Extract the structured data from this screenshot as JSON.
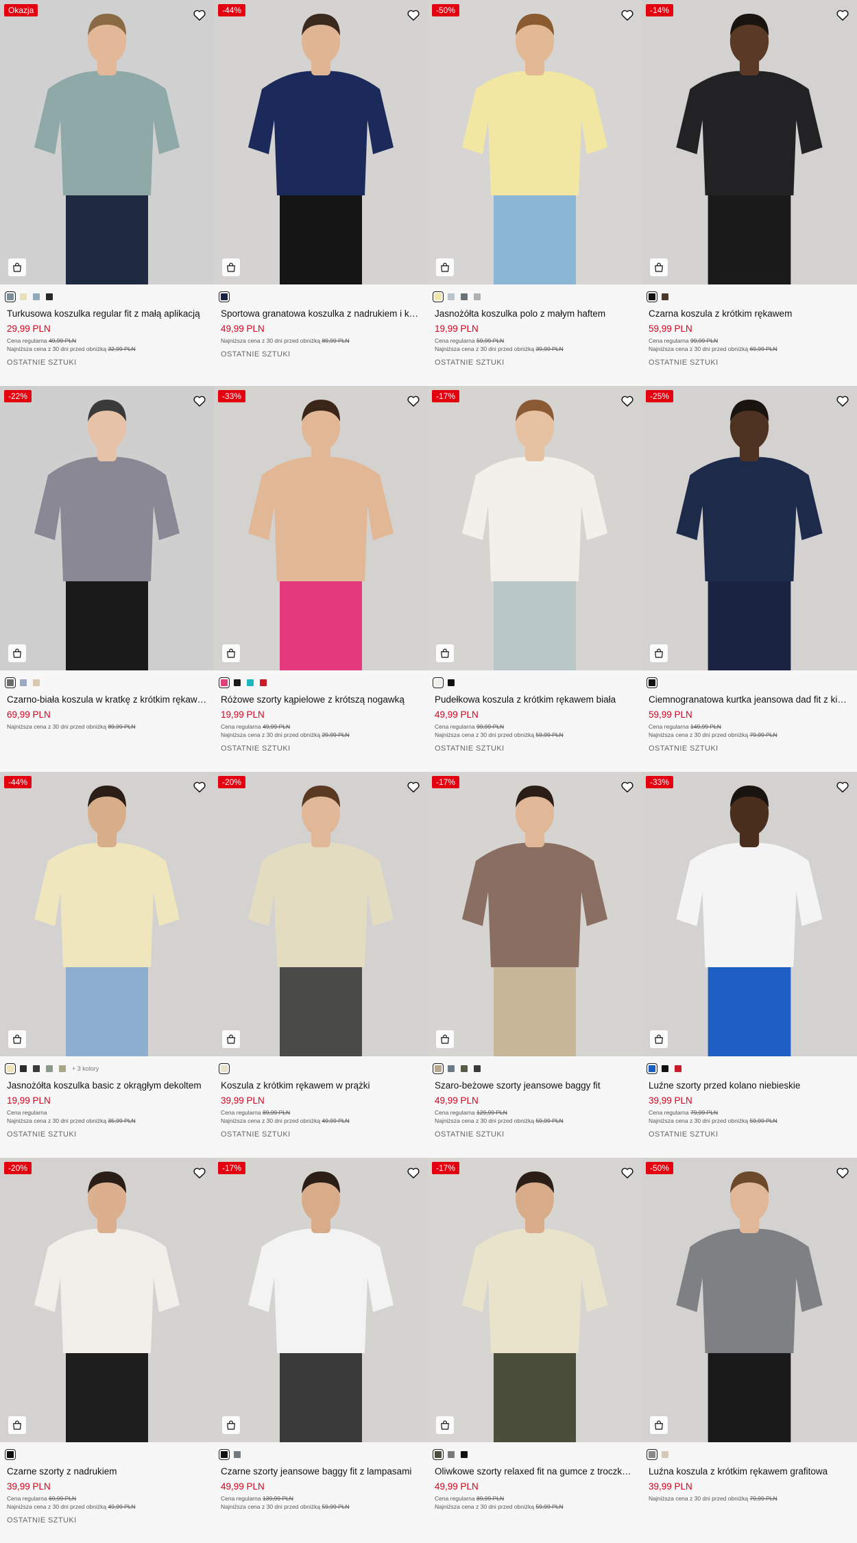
{
  "colors": {
    "badge": "#e3000f",
    "price": "#d6001c"
  },
  "products": [
    {
      "badge": "Okazja",
      "name": "Turkusowa koszulka regular fit z małą aplikacją",
      "price": "29,99 PLN",
      "regular_label": "Cena regularna",
      "regular": "49,99 PLN",
      "lowest_label": "Najniższa cena z 30 dni przed obniżką",
      "lowest": "32,99 PLN",
      "last": "OSTATNIE SZTUKI",
      "swatches": [
        "#7a8f96",
        "#e8e0b8",
        "#8fa9b8",
        "#2a2a2a"
      ],
      "more": "",
      "bg": "#cfd0cf",
      "shirt": "#8fa8a8",
      "pants": "#1e2a40",
      "skin": "#e2b899",
      "hair": "#8a6a44"
    },
    {
      "badge": "-44%",
      "name": "Sportowa granatowa koszulka z nadrukiem i kołnierzykiem",
      "price": "49,99 PLN",
      "regular_label": "",
      "regular": "",
      "lowest_label": "Najniższa cena z 30 dni przed obniżką",
      "lowest": "89,99 PLN",
      "last": "OSTATNIE SZTUKI",
      "swatches": [
        "#1a2340"
      ],
      "more": "",
      "bg": "#d4d3d1",
      "shirt": "#1b2a5a",
      "pants": "#151515",
      "skin": "#e0b594",
      "hair": "#3a2a1e"
    },
    {
      "badge": "-50%",
      "name": "Jasnożółta koszulka polo z małym haftem",
      "price": "19,99 PLN",
      "regular_label": "Cena regularna",
      "regular": "59,99 PLN",
      "lowest_label": "Najniższa cena z 30 dni przed obniżką",
      "lowest": "39,99 PLN",
      "last": "OSTATNIE SZTUKI",
      "swatches": [
        "#f0e6a8",
        "#b9c4cc",
        "#6c7378",
        "#b0b0b0"
      ],
      "more": "",
      "bg": "#d6d5d3",
      "shirt": "#f1e7a2",
      "pants": "#8bb6d6",
      "skin": "#e3b995",
      "hair": "#8a5a30"
    },
    {
      "badge": "-14%",
      "name": "Czarna koszula z krótkim rękawem",
      "price": "59,99 PLN",
      "regular_label": "Cena regularna",
      "regular": "99,99 PLN",
      "lowest_label": "Najniższa cena z 30 dni przed obniżką",
      "lowest": "69,99 PLN",
      "last": "OSTATNIE SZTUKI",
      "swatches": [
        "#111111",
        "#4a3a2a"
      ],
      "more": "",
      "bg": "#d3d2d0",
      "shirt": "#222224",
      "pants": "#1a1a1a",
      "skin": "#5a3a26",
      "hair": "#1a1410"
    },
    {
      "badge": "-22%",
      "name": "Czarno-biała koszula w kratkę z krótkim rękawem",
      "price": "69,99 PLN",
      "regular_label": "",
      "regular": "",
      "lowest_label": "Najniższa cena z 30 dni przed obniżką",
      "lowest": "89,99 PLN",
      "last": "",
      "swatches": [
        "#6c6c6c",
        "#9aa8c2",
        "#d8c8b0"
      ],
      "more": "",
      "bg": "#cfcfcf",
      "shirt": "#8a8894",
      "pants": "#1a1a1a",
      "skin": "#e6c3a8",
      "hair": "#3a3a3a"
    },
    {
      "badge": "-33%",
      "name": "Różowe szorty kąpielowe z krótszą nogawką",
      "price": "19,99 PLN",
      "regular_label": "Cena regularna",
      "regular": "49,99 PLN",
      "lowest_label": "Najniższa cena z 30 dni przed obniżką",
      "lowest": "29,99 PLN",
      "last": "OSTATNIE SZTUKI",
      "swatches": [
        "#e0407a",
        "#1a1a1a",
        "#1ab7c0",
        "#cc1a2a"
      ],
      "more": "",
      "bg": "#d3d2cf",
      "shirt": "#e1b796",
      "pants": "#e23a7c",
      "skin": "#e1b796",
      "hair": "#3a2618"
    },
    {
      "badge": "-17%",
      "name": "Pudełkowa koszula z krótkim rękawem biała",
      "price": "49,99 PLN",
      "regular_label": "Cena regularna",
      "regular": "99,99 PLN",
      "lowest_label": "Najniższa cena z 30 dni przed obniżką",
      "lowest": "59,99 PLN",
      "last": "OSTATNIE SZTUKI",
      "swatches": [
        "#eeeeea",
        "#111111"
      ],
      "more": "",
      "bg": "#d5d4d1",
      "shirt": "#f1f0ea",
      "pants": "#b9c7c9",
      "skin": "#e6c1a2",
      "hair": "#8a5a34"
    },
    {
      "badge": "-25%",
      "name": "Ciemnogranatowa kurtka jeansowa dad fit z kieszeniami",
      "price": "59,99 PLN",
      "regular_label": "Cena regularna",
      "regular": "149,99 PLN",
      "lowest_label": "Najniższa cena z 30 dni przed obniżką",
      "lowest": "79,99 PLN",
      "last": "OSTATNIE SZTUKI",
      "swatches": [
        "#111111"
      ],
      "more": "",
      "bg": "#d3d2d0",
      "shirt": "#1d2a4a",
      "pants": "#1a2440",
      "skin": "#4e3222",
      "hair": "#1a1410"
    },
    {
      "badge": "-44%",
      "name": "Jasnożółta koszulka basic z okrągłym dekoltem",
      "price": "19,99 PLN",
      "regular_label": "Cena regularna",
      "regular": "",
      "lowest_label": "Najniższa cena z 30 dni przed obniżką",
      "lowest": "35,99 PLN",
      "last": "OSTATNIE SZTUKI",
      "swatches": [
        "#efe3b8",
        "#2a2a2a",
        "#3a3a3a",
        "#8a9a8a",
        "#a8a888"
      ],
      "more": "+ 3 kolory",
      "bg": "#d3d2d0",
      "shirt": "#efe6be",
      "pants": "#8eaed0",
      "skin": "#d8ae8a",
      "hair": "#2a1e16"
    },
    {
      "badge": "-20%",
      "name": "Koszula z krótkim rękawem w prążki",
      "price": "39,99 PLN",
      "regular_label": "Cena regularna",
      "regular": "89,99 PLN",
      "lowest_label": "Najniższa cena z 30 dni przed obniżką",
      "lowest": "49,99 PLN",
      "last": "OSTATNIE SZTUKI",
      "swatches": [
        "#e6e2cc"
      ],
      "more": "",
      "bg": "#d3d2d0",
      "shirt": "#e4dcc0",
      "pants": "#4a4a48",
      "skin": "#e0b898",
      "hair": "#5a3a22"
    },
    {
      "badge": "-17%",
      "name": "Szaro-beżowe szorty jeansowe baggy fit",
      "price": "49,99 PLN",
      "regular_label": "Cena regularna",
      "regular": "129,99 PLN",
      "lowest_label": "Najniższa cena z 30 dni przed obniżką",
      "lowest": "59,99 PLN",
      "last": "OSTATNIE SZTUKI",
      "swatches": [
        "#b8a890",
        "#6a7a88",
        "#5a5a48",
        "#3a3a3a"
      ],
      "more": "",
      "bg": "#d5d4d1",
      "shirt": "#8a6e62",
      "pants": "#c7b89a",
      "skin": "#e0b898",
      "hair": "#2a1e16"
    },
    {
      "badge": "-33%",
      "name": "Luźne szorty przed kolano niebieskie",
      "price": "39,99 PLN",
      "regular_label": "Cena regularna",
      "regular": "79,99 PLN",
      "lowest_label": "Najniższa cena z 30 dni przed obniżką",
      "lowest": "59,99 PLN",
      "last": "OSTATNIE SZTUKI",
      "swatches": [
        "#1a5fc0",
        "#111111",
        "#cc1a2a"
      ],
      "more": "",
      "bg": "#d3d2d0",
      "shirt": "#f4f4f4",
      "pants": "#1f5fc4",
      "skin": "#4a2e1e",
      "hair": "#1a1410"
    },
    {
      "badge": "-20%",
      "name": "Czarne szorty z nadrukiem",
      "price": "39,99 PLN",
      "regular_label": "Cena regularna",
      "regular": "69,99 PLN",
      "lowest_label": "Najniższa cena z 30 dni przed obniżką",
      "lowest": "49,99 PLN",
      "last": "OSTATNIE SZTUKI",
      "swatches": [
        "#111111"
      ],
      "more": "",
      "bg": "#d3d2d0",
      "shirt": "#f0efea",
      "pants": "#1e1e1e",
      "skin": "#dcb08e",
      "hair": "#2a1e16"
    },
    {
      "badge": "-17%",
      "name": "Czarne szorty jeansowe baggy fit z lampasami",
      "price": "49,99 PLN",
      "regular_label": "Cena regularna",
      "regular": "139,99 PLN",
      "lowest_label": "Najniższa cena z 30 dni przed obniżką",
      "lowest": "59,99 PLN",
      "last": "",
      "swatches": [
        "#111111",
        "#707a80"
      ],
      "more": "",
      "bg": "#d4d3d0",
      "shirt": "#f3f3f3",
      "pants": "#3a3a3a",
      "skin": "#d8ac88",
      "hair": "#2a1e16"
    },
    {
      "badge": "-17%",
      "name": "Oliwkowe szorty relaxed fit na gumce z troczkami",
      "price": "49,99 PLN",
      "regular_label": "Cena regularna",
      "regular": "89,99 PLN",
      "lowest_label": "Najniższa cena z 30 dni przed obniżką",
      "lowest": "59,99 PLN",
      "last": "",
      "swatches": [
        "#4a5040",
        "#7a7a7a",
        "#111111"
      ],
      "more": "",
      "bg": "#d6d5d2",
      "shirt": "#e9e3cc",
      "pants": "#4a4e3a",
      "skin": "#d8ac88",
      "hair": "#2a1e16"
    },
    {
      "badge": "-50%",
      "name": "Luźna koszula z krótkim rękawem grafitowa",
      "price": "39,99 PLN",
      "regular_label": "",
      "regular": "",
      "lowest_label": "Najniższa cena z 30 dni przed obniżką",
      "lowest": "79,99 PLN",
      "last": "",
      "swatches": [
        "#8a8a8a",
        "#d8c8b8"
      ],
      "more": "",
      "bg": "#d3d2d0",
      "shirt": "#7e8084",
      "pants": "#1a1a1a",
      "skin": "#e0b898",
      "hair": "#6a4a2a"
    }
  ]
}
